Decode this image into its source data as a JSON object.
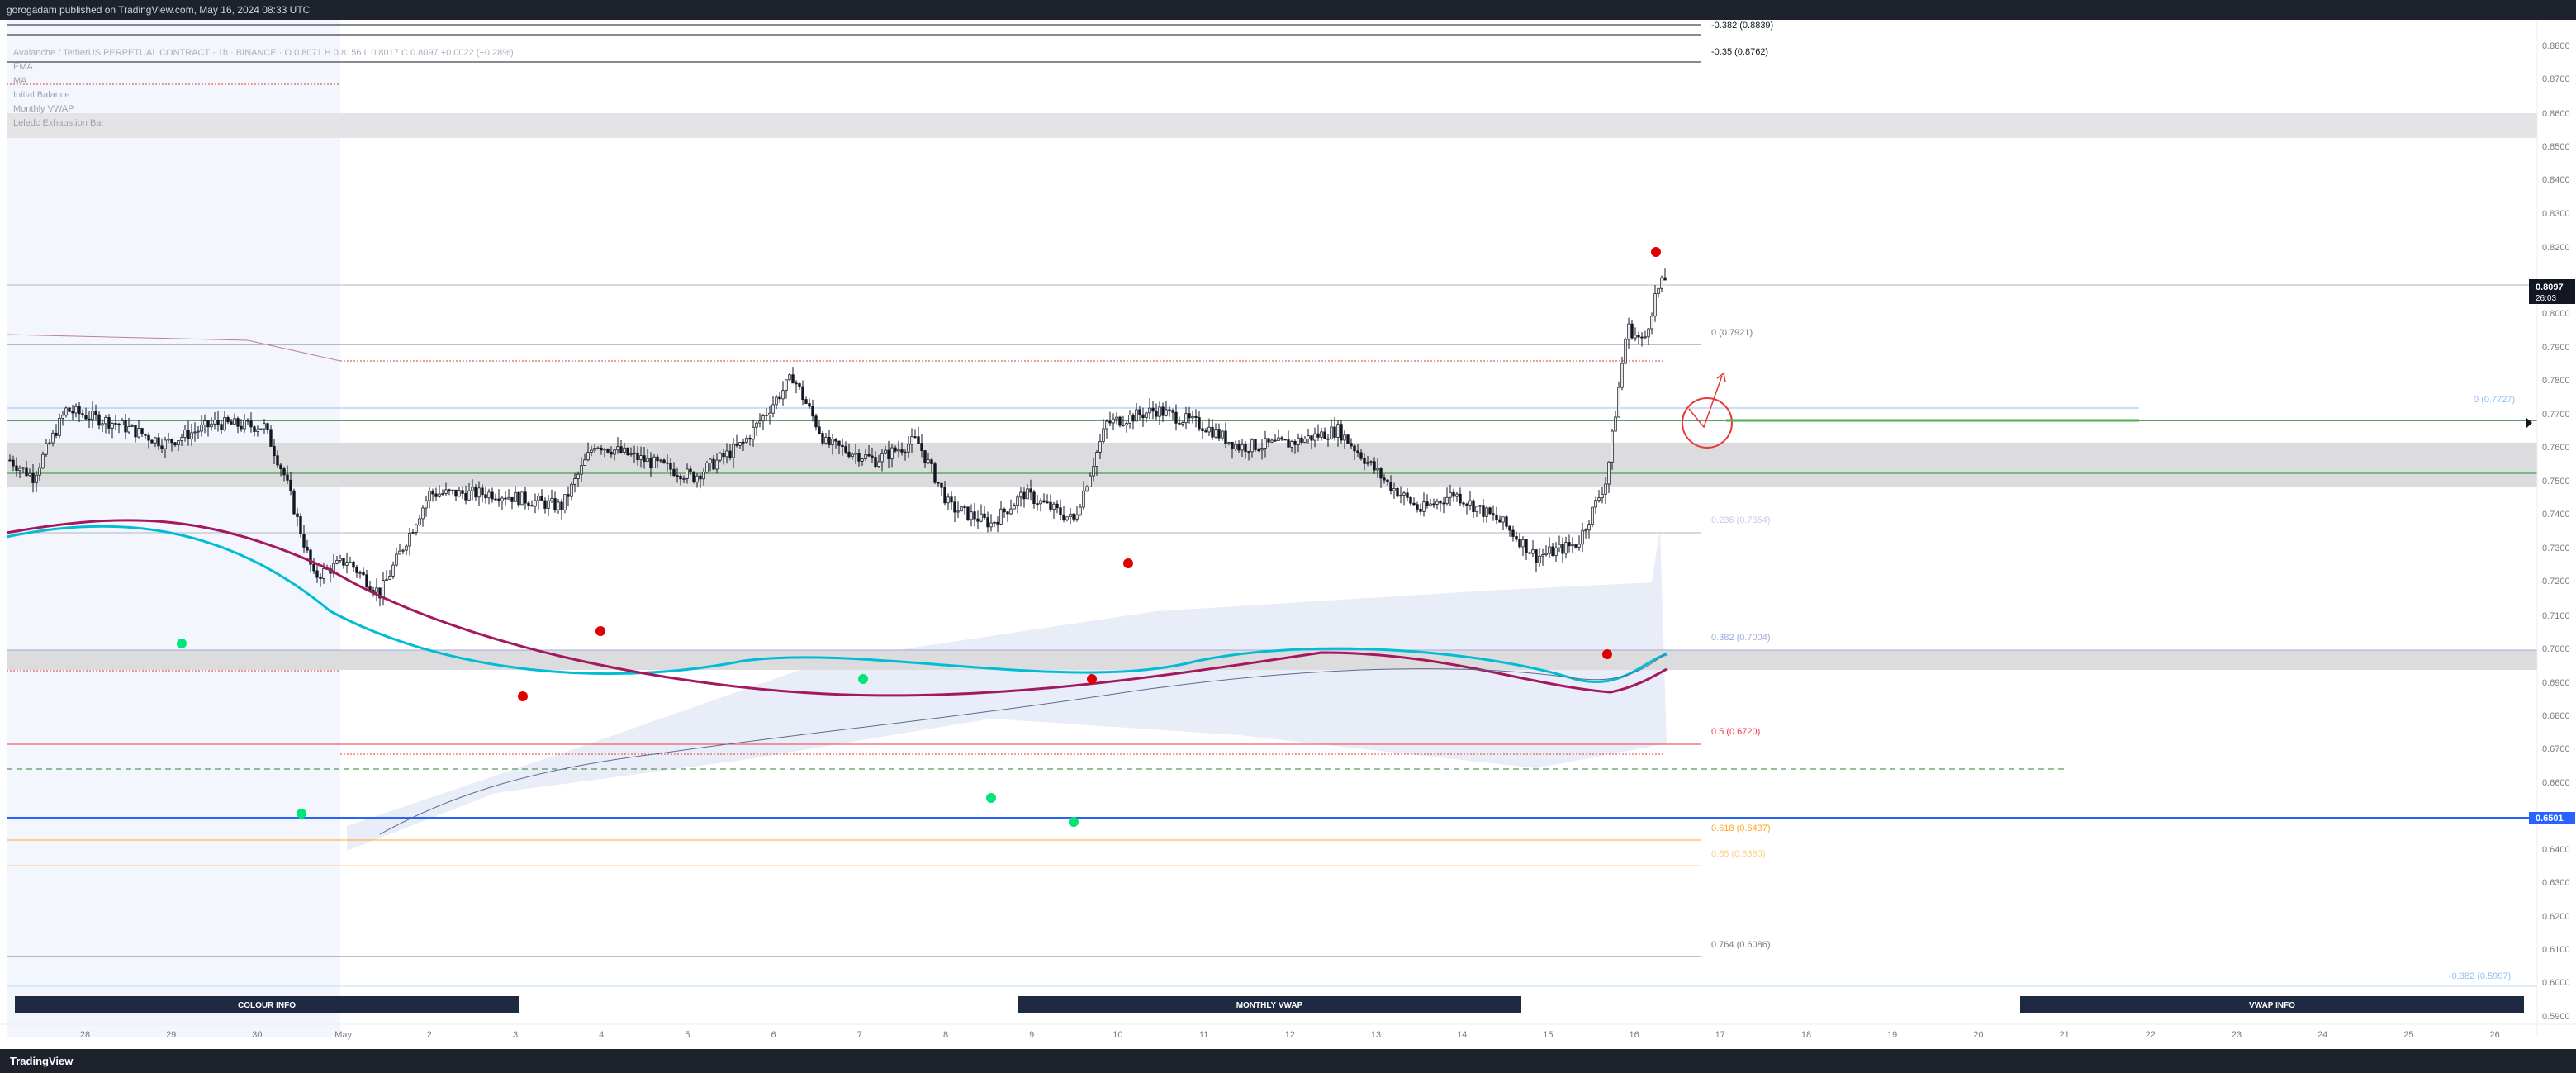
{
  "header": {
    "published_text": "gorogadam published on TradingView.com, May 16, 2024 08:33 UTC"
  },
  "legend": {
    "symbol_line": "Avalanche / TetherUS PERPETUAL CONTRACT · 1h · BINANCE · O 0.8071 H 0.8156 L 0.8017 C 0.8097 +0.0022 (+0.28%)",
    "items": [
      "EMA",
      "MA",
      "Initial Balance",
      "Monthly VWAP",
      "Leledc Exhaustion Bar"
    ]
  },
  "price_axis": {
    "ticks": [
      "0.8800",
      "0.8700",
      "0.8600",
      "0.8500",
      "0.8400",
      "0.8300",
      "0.8200",
      "0.8000",
      "0.7900",
      "0.7800",
      "0.7700",
      "0.7600",
      "0.7500",
      "0.7400",
      "0.7300",
      "0.7200",
      "0.7100",
      "0.7000",
      "0.6900",
      "0.6800",
      "0.6700",
      "0.6600",
      "0.6400",
      "0.6300",
      "0.6200",
      "0.6100",
      "0.6000",
      "0.5900"
    ],
    "current_price": "0.8097",
    "countdown": "26:03",
    "marked_level": "0.6501",
    "current_color": "#131722",
    "marked_color": "#2962ff"
  },
  "time_axis": {
    "labels": [
      "28",
      "29",
      "30",
      "May",
      "2",
      "3",
      "4",
      "5",
      "6",
      "7",
      "8",
      "9",
      "10",
      "11",
      "12",
      "13",
      "14",
      "15",
      "16",
      "17",
      "18",
      "19",
      "20",
      "21",
      "22",
      "23",
      "24",
      "25",
      "26"
    ]
  },
  "fib_labels": [
    {
      "text": "-0.382 (0.8839)",
      "color": "#131722"
    },
    {
      "text": "-0.35 (0.8762)",
      "color": "#131722"
    },
    {
      "text": "0 (0.7921)",
      "color": "#787b86"
    },
    {
      "text": "0 (0.7727)",
      "color": "#90bff9"
    },
    {
      "text": "0.236 (0.7354)",
      "color": "#c5cae9"
    },
    {
      "text": "0.382 (0.7004)",
      "color": "#9fa8da"
    },
    {
      "text": "0.5 (0.6720)",
      "color": "#f23645"
    },
    {
      "text": "0.618 (0.6437)",
      "color": "#ffa726"
    },
    {
      "text": "0.65 (0.6360)",
      "color": "#ffcc80"
    },
    {
      "text": "0.764 (0.6086)",
      "color": "#787b86"
    },
    {
      "text": "-0.382 (0.5997)",
      "color": "#90bff9"
    }
  ],
  "info_boxes": [
    "COLOUR INFO",
    "MONTHLY VWAP",
    "VWAP INFO"
  ],
  "footer": {
    "brand": "TradingView"
  },
  "colors": {
    "ema_fast": "#00bcd4",
    "ema_slow": "#a3185f",
    "vwap_band": "#e8edf8",
    "support_blue": "#2962ff",
    "entry_green": "#4caf50",
    "target_red": "#e53935"
  }
}
